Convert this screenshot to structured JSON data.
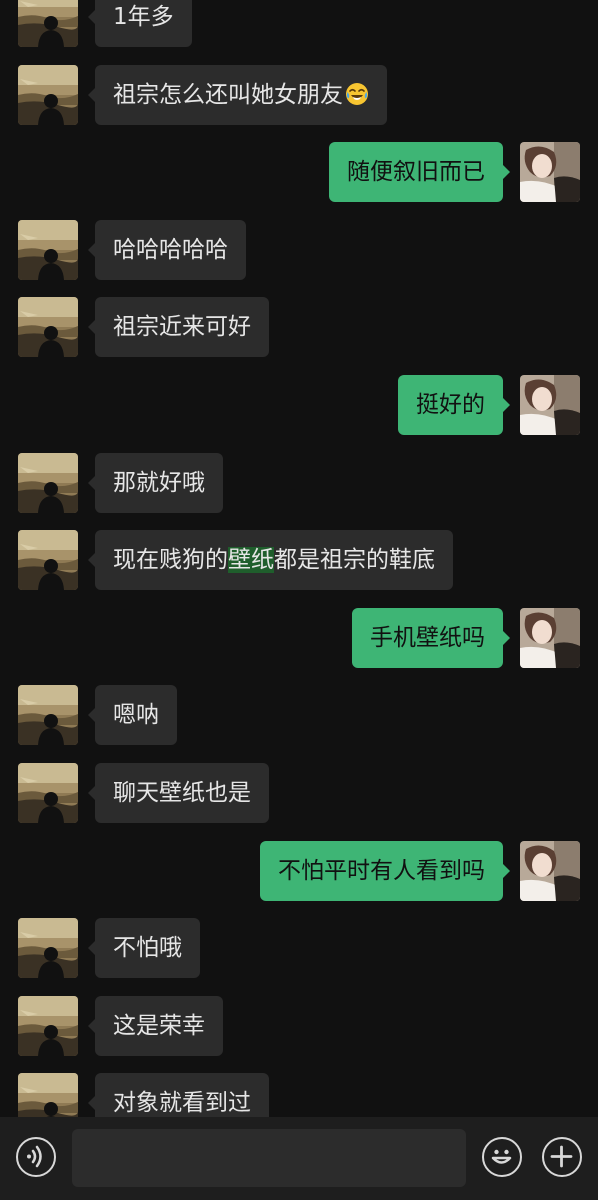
{
  "chat": {
    "messages": [
      {
        "side": "left",
        "text": "1年多"
      },
      {
        "side": "left",
        "text": "祖宗怎么还叫她女朋友",
        "emoji": "face-with-tears-of-joy-icon"
      },
      {
        "side": "right",
        "text": "随便叙旧而已"
      },
      {
        "side": "left",
        "text": "哈哈哈哈哈"
      },
      {
        "side": "left",
        "text": "祖宗近来可好"
      },
      {
        "side": "right",
        "text": "挺好的"
      },
      {
        "side": "left",
        "text": "那就好哦"
      },
      {
        "side": "left",
        "text_before": "现在贱狗的",
        "text_highlight": "壁纸",
        "text_after": "都是祖宗的鞋底"
      },
      {
        "side": "right",
        "text": "手机壁纸吗"
      },
      {
        "side": "left",
        "text": "嗯呐"
      },
      {
        "side": "left",
        "text": "聊天壁纸也是"
      },
      {
        "side": "right",
        "text": "不怕平时有人看到吗"
      },
      {
        "side": "left",
        "text": "不怕哦"
      },
      {
        "side": "left",
        "text": "这是荣幸"
      },
      {
        "side": "left",
        "text": "对象就看到过"
      }
    ]
  },
  "input_bar": {
    "voice_icon": "voice-icon",
    "emoji_icon": "emoji-icon",
    "plus_icon": "plus-icon",
    "input_value": ""
  },
  "colors": {
    "background": "#111111",
    "incoming_bubble": "#2c2c2c",
    "outgoing_bubble": "#3eb575",
    "highlight": "#1f5e2c"
  }
}
